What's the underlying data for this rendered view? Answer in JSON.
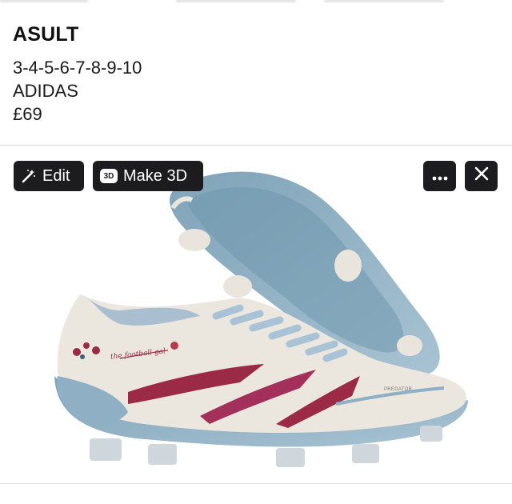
{
  "listing": {
    "title": "ASULT",
    "sizes": "3-4-5-6-7-8-9-10",
    "brand": "ADIDAS",
    "price": "£69"
  },
  "toolbar": {
    "edit_label": "Edit",
    "edit_icon": "magic-wand-icon",
    "make3d_label": "Make 3D",
    "make3d_badge": "3D",
    "more_icon": "ellipsis-icon",
    "close_icon": "close-icon"
  },
  "photo": {
    "subject": "football boot pair",
    "boot_script_text": "the football gal",
    "side_text": "PREDATOR",
    "colors": {
      "upper": "#ece7de",
      "stripes": "#9a2a45",
      "soleplate": "#8fb0c4",
      "laces": "#a9c3d6"
    }
  }
}
